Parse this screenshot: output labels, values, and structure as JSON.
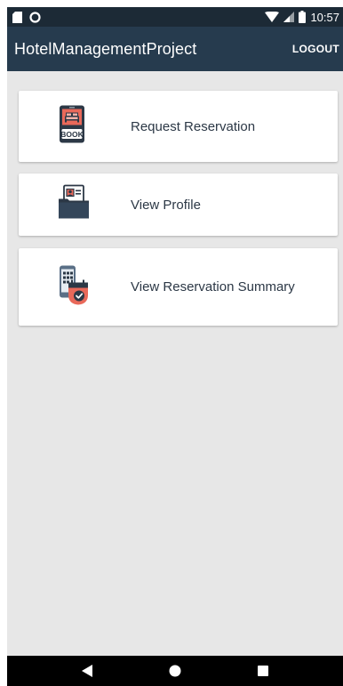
{
  "status_bar": {
    "time": "10:57"
  },
  "app_bar": {
    "title": "HotelManagementProject",
    "logout_label": "LOGOUT"
  },
  "menu": {
    "items": [
      {
        "label": "Request Reservation",
        "icon": "book-room-icon",
        "icon_text": "BOOK"
      },
      {
        "label": "View Profile",
        "icon": "profile-folder-icon"
      },
      {
        "label": "View Reservation Summary",
        "icon": "reservation-summary-icon"
      }
    ]
  },
  "nav_bar": {
    "buttons": [
      "back-icon",
      "home-icon",
      "recents-icon"
    ]
  },
  "colors": {
    "status_bar": "#1c2a36",
    "app_bar": "#263b4e",
    "background": "#e7e7e7",
    "accent_red": "#e9695a",
    "icon_dark": "#2c3846"
  }
}
